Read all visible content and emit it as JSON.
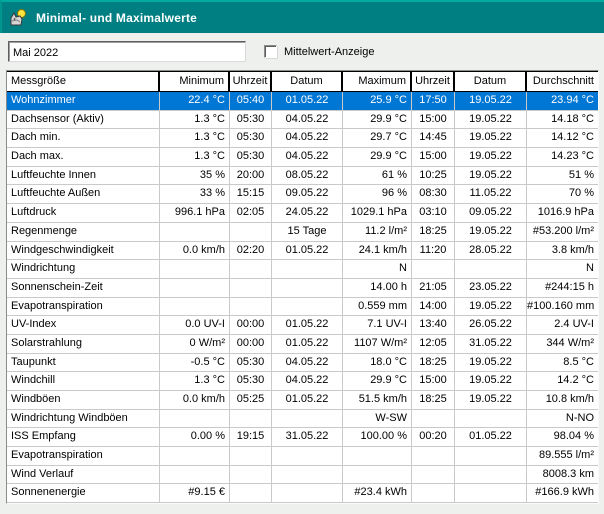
{
  "window": {
    "title": "Minimal- und Maximalwerte"
  },
  "controls": {
    "period_value": "Mai 2022",
    "checkbox_label": "Mittelwert-Anzeige",
    "checkbox_checked": false
  },
  "colors": {
    "titlebar": "#007f83",
    "titlebar_highlight": "#00ab9e",
    "selection_blue": "#0077d4",
    "window_bg": "#eef0ee",
    "grid_line": "#c9c9c9",
    "header_line": "#000000"
  },
  "table": {
    "headers": [
      "Messgröße",
      "Minimum",
      "Uhrzeit",
      "Datum",
      "Maximum",
      "Uhrzeit",
      "Datum",
      "Durchschnitt"
    ],
    "selected_row": 0,
    "rows": [
      [
        "Wohnzimmer",
        "22.4 °C",
        "05:40",
        "01.05.22",
        "25.9 °C",
        "17:50",
        "19.05.22",
        "23.94 °C"
      ],
      [
        "Dachsensor (Aktiv)",
        "1.3 °C",
        "05:30",
        "04.05.22",
        "29.9 °C",
        "15:00",
        "19.05.22",
        "14.18 °C"
      ],
      [
        "Dach min.",
        "1.3 °C",
        "05:30",
        "04.05.22",
        "29.7 °C",
        "14:45",
        "19.05.22",
        "14.12 °C"
      ],
      [
        "Dach max.",
        "1.3 °C",
        "05:30",
        "04.05.22",
        "29.9 °C",
        "15:00",
        "19.05.22",
        "14.23 °C"
      ],
      [
        "Luftfeuchte Innen",
        "35 %",
        "20:00",
        "08.05.22",
        "61 %",
        "10:25",
        "19.05.22",
        "51 %"
      ],
      [
        "Luftfeuchte Außen",
        "33 %",
        "15:15",
        "09.05.22",
        "96 %",
        "08:30",
        "11.05.22",
        "70 %"
      ],
      [
        "Luftdruck",
        "996.1 hPa",
        "02:05",
        "24.05.22",
        "1029.1 hPa",
        "03:10",
        "09.05.22",
        "1016.9 hPa"
      ],
      [
        "Regenmenge",
        "",
        "",
        "15 Tage",
        "11.2 l/m²",
        "18:25",
        "19.05.22",
        "#53.200 l/m²"
      ],
      [
        "Windgeschwindigkeit",
        "0.0 km/h",
        "02:20",
        "01.05.22",
        "24.1 km/h",
        "11:20",
        "28.05.22",
        "3.8 km/h"
      ],
      [
        "Windrichtung",
        "",
        "",
        "",
        "N",
        "",
        "",
        "N"
      ],
      [
        "Sonnenschein-Zeit",
        "",
        "",
        "",
        "14.00 h",
        "21:05",
        "23.05.22",
        "#244:15 h"
      ],
      [
        "Evapotranspiration",
        "",
        "",
        "",
        "0.559 mm",
        "14:00",
        "19.05.22",
        "#100.160 mm"
      ],
      [
        "UV-Index",
        "0.0 UV-I",
        "00:00",
        "01.05.22",
        "7.1 UV-I",
        "13:40",
        "26.05.22",
        "2.4 UV-I"
      ],
      [
        "Solarstrahlung",
        "0 W/m²",
        "00:00",
        "01.05.22",
        "1107 W/m²",
        "12:05",
        "31.05.22",
        "344 W/m²"
      ],
      [
        "Taupunkt",
        "-0.5 °C",
        "05:30",
        "04.05.22",
        "18.0 °C",
        "18:25",
        "19.05.22",
        "8.5 °C"
      ],
      [
        "Windchill",
        "1.3 °C",
        "05:30",
        "04.05.22",
        "29.9 °C",
        "15:00",
        "19.05.22",
        "14.2 °C"
      ],
      [
        "Windböen",
        "0.0 km/h",
        "05:25",
        "01.05.22",
        "51.5 km/h",
        "18:25",
        "19.05.22",
        "10.8 km/h"
      ],
      [
        "Windrichtung Windböen",
        "",
        "",
        "",
        "W-SW",
        "",
        "",
        "N-NO"
      ],
      [
        "ISS Empfang",
        "0.00 %",
        "19:15",
        "31.05.22",
        "100.00 %",
        "00:20",
        "01.05.22",
        "98.04 %"
      ],
      [
        "Evapotranspiration",
        "",
        "",
        "",
        "",
        "",
        "",
        "89.555 l/m²"
      ],
      [
        "Wind Verlauf",
        "",
        "",
        "",
        "",
        "",
        "",
        "8008.3 km"
      ],
      [
        "Sonnenenergie",
        "#9.15 €",
        "",
        "",
        "#23.4 kWh",
        "",
        "",
        "#166.9 kWh"
      ]
    ]
  }
}
